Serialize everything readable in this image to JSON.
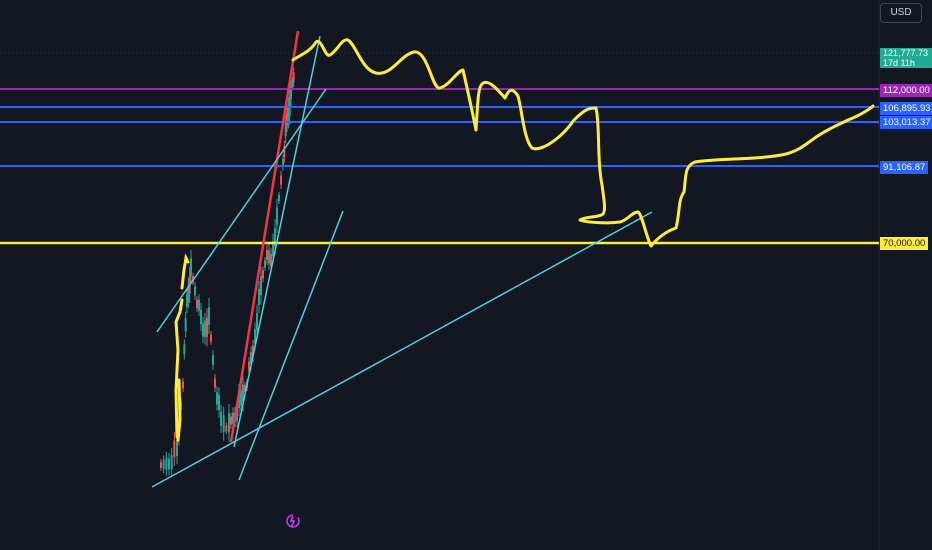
{
  "toolbar": {
    "currency_label": "USD"
  },
  "current_price": {
    "price": "121,777.73",
    "countdown": "17d 11h",
    "color": "#22ab94"
  },
  "levels": [
    {
      "label": "112,000.00",
      "color": "#9c27b0",
      "text_color": "#ffffff"
    },
    {
      "label": "106,895.93",
      "color": "#2962ff",
      "text_color": "#ffffff"
    },
    {
      "label": "103,013.37",
      "color": "#2962ff",
      "text_color": "#ffffff"
    },
    {
      "label": "91,106.87",
      "color": "#2962ff",
      "text_color": "#ffffff"
    },
    {
      "label": "70,000.00",
      "color": "#ffeb3b",
      "text_color": "#131722"
    }
  ],
  "colors": {
    "background": "#131722",
    "trendline": "#4dd0e1",
    "projection": "#ffeb3b",
    "red_trendline": "#f23645",
    "candle_up": "#26a69a",
    "candle_down": "#ef5350",
    "grid": "#2a2e39"
  },
  "icons": {
    "replay": "replay-icon"
  }
}
